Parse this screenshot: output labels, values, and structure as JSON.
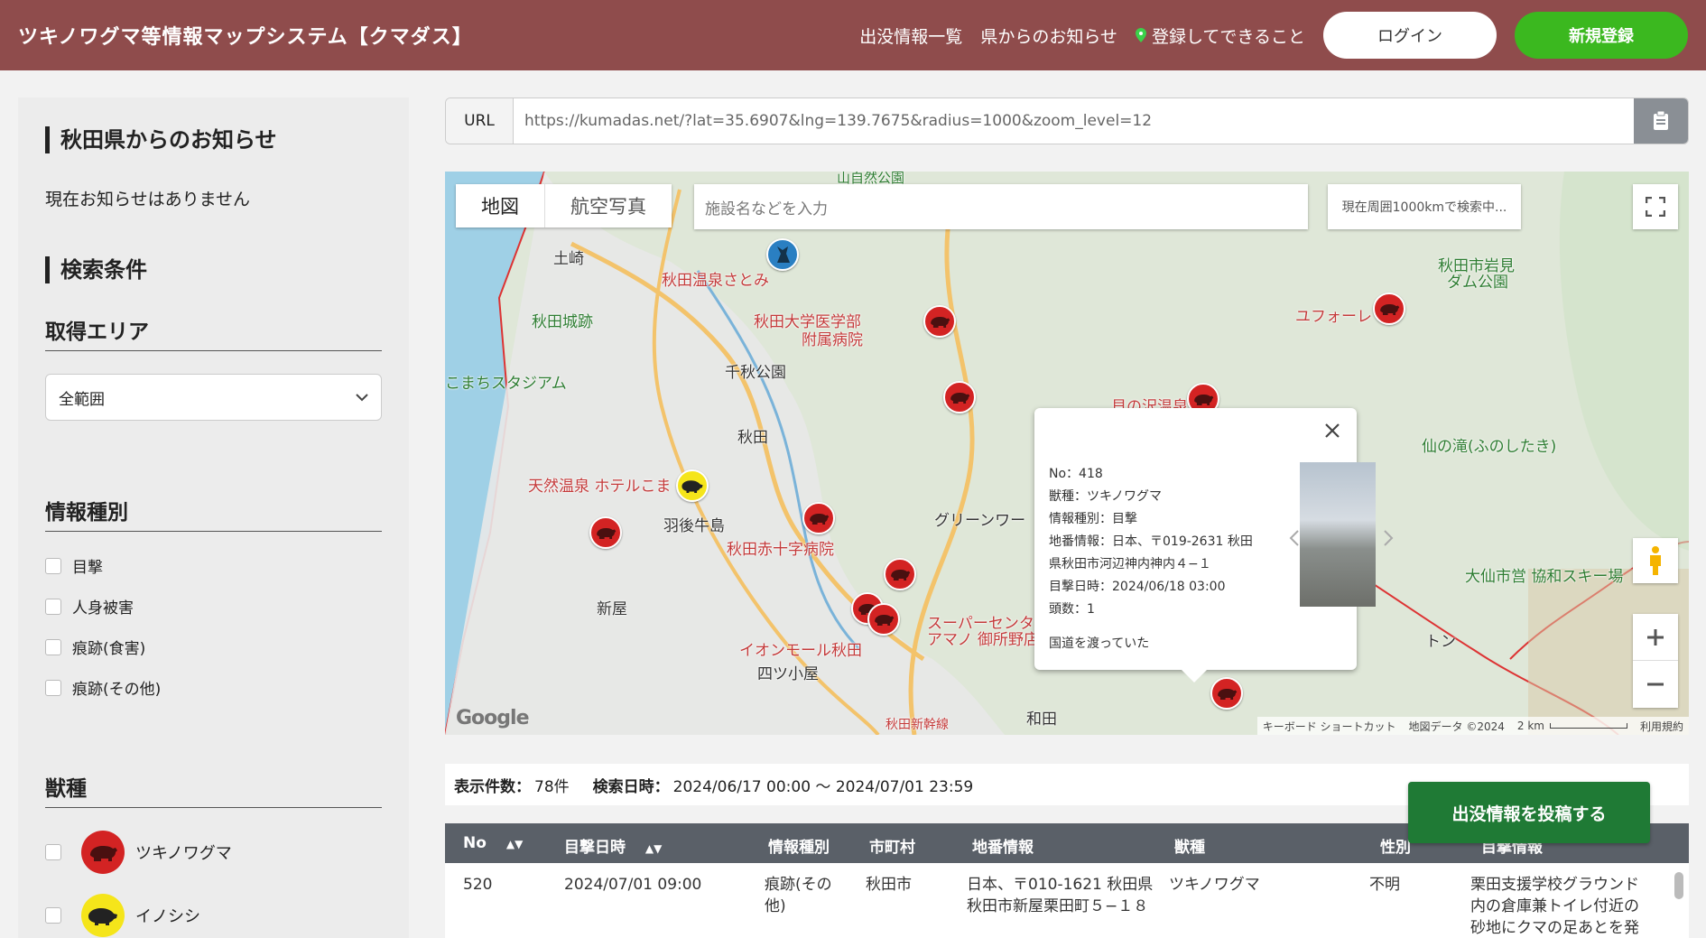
{
  "header": {
    "title": "ツキノワグマ等情報マップシステム【クマダス】",
    "nav": [
      "出没情報一覧",
      "県からのお知らせ",
      "登録してできること"
    ],
    "login": "ログイン",
    "register": "新規登録"
  },
  "sidebar": {
    "notice_title": "秋田県からのお知らせ",
    "notice_text": "現在お知らせはありません",
    "search_title": "検索条件",
    "area_title": "取得エリア",
    "area_value": "全範囲",
    "type_title": "情報種別",
    "types": [
      "目撃",
      "人身被害",
      "痕跡(食害)",
      "痕跡(その他)"
    ],
    "animal_title": "獣種",
    "animals": [
      "ツキノワグマ",
      "イノシシ"
    ]
  },
  "url": {
    "label": "URL",
    "value": "https://kumadas.net/?lat=35.6907&lng=139.7675&radius=1000&zoom_level=12"
  },
  "map": {
    "tab_map": "地図",
    "tab_satellite": "航空写真",
    "search_placeholder": "施設名などを入力",
    "radius_text": "現在周囲1000kmで検索中...",
    "places": [
      "山自然公園",
      "土崎",
      "秋田温泉さとみ",
      "秋田城跡",
      "秋田大学医学部",
      "附属病院",
      "千秋公園",
      "こまちスタジアム",
      "秋田",
      "天然温泉 ホテルこま",
      "羽後牛島",
      "秋田赤十字病院",
      "新屋",
      "イオンモール秋田",
      "四ツ小屋",
      "グリーンワー",
      "スーパーセンタ",
      "アマノ 御所野店",
      "貝の沢温泉",
      "ユフォーレ",
      "秋田市岩見",
      "ダム公園",
      "仙の滝(ふのしたき)",
      "大仙市営 協和スキー場",
      "トン",
      "和田",
      "秋田新幹線"
    ],
    "popup": {
      "no": "No：418",
      "species": "獣種：ツキノワグマ",
      "type": "情報種別：目撃",
      "address1": "地番情報：日本、〒019-2631 秋田",
      "address2": "県秋田市河辺神内神内４−１",
      "date": "目撃日時：2024/06/18 03:00",
      "count": "頭数：1",
      "note": "国道を渡っていた"
    },
    "footer": [
      "キーボード ショートカット",
      "地図データ ©2024",
      "2 km",
      "利用規約"
    ],
    "google": "Google"
  },
  "results": {
    "count_label": "表示件数：",
    "count_value": "78件",
    "date_label": "検索日時：",
    "date_value": "2024/06/17 00:00 〜 2024/07/01 23:59"
  },
  "post_button": "出没情報を投稿する",
  "table": {
    "headers": [
      "No",
      "目撃日時",
      "情報種別",
      "市町村",
      "地番情報",
      "獣種",
      "性別",
      "目撃情報"
    ],
    "row": {
      "no": "520",
      "date": "2024/07/01 09:00",
      "type1": "痕跡(その",
      "type2": "他)",
      "city": "秋田市",
      "addr1": "日本、〒010-1621 秋田県",
      "addr2": "秋田市新屋栗田町５−１８",
      "species": "ツキノワグマ",
      "sex": "不明",
      "info1": "栗田支援学校グラウンド",
      "info2": "内の倉庫兼トイレ付近の",
      "info3": "砂地にクマの足あとを発"
    }
  },
  "colors": {
    "header": "#8f4c4c",
    "register": "#3bb81f",
    "post": "#1f7a35",
    "bear_marker": "#d32323",
    "boar_marker": "#f5e51a"
  }
}
